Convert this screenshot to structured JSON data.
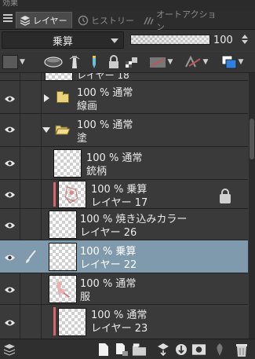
{
  "top_strip": {
    "label": "効果"
  },
  "tabs": [
    {
      "label": "レイヤー",
      "icon": "layers-icon"
    },
    {
      "label": "ヒストリー",
      "icon": "history-icon"
    },
    {
      "label": "オートアクション",
      "icon": "auto-action-icon"
    }
  ],
  "blend_mode": {
    "value": "乗算"
  },
  "opacity": {
    "value": "100",
    "level": 1.0
  },
  "layers": [
    {
      "line1": "100 % 通常",
      "line2": "線画",
      "type": "folder",
      "expanded": false
    },
    {
      "line1": "100 % 通常",
      "line2": "塗",
      "type": "folder",
      "expanded": true
    },
    {
      "line1": "100 % 通常",
      "line2": "銃柄"
    },
    {
      "line1": "100 % 乗算",
      "line2": "レイヤー 17",
      "locked": true,
      "clipping": true
    },
    {
      "line1": "100 % 焼き込みカラー",
      "line2": "レイヤー 26"
    },
    {
      "line1": "100 % 乗算",
      "line2": "レイヤー 22",
      "selected": true
    },
    {
      "line1": "100 % 通常",
      "line2": "服"
    },
    {
      "line1": "100 % 通常",
      "line2": "レイヤー 23",
      "clipping": true
    }
  ],
  "partial_top_layer": {
    "text": "レイヤー 18"
  },
  "colors": {
    "clip_mark": "#d9646c",
    "selection": "#7f9aad",
    "folder": "#e9d27a"
  }
}
